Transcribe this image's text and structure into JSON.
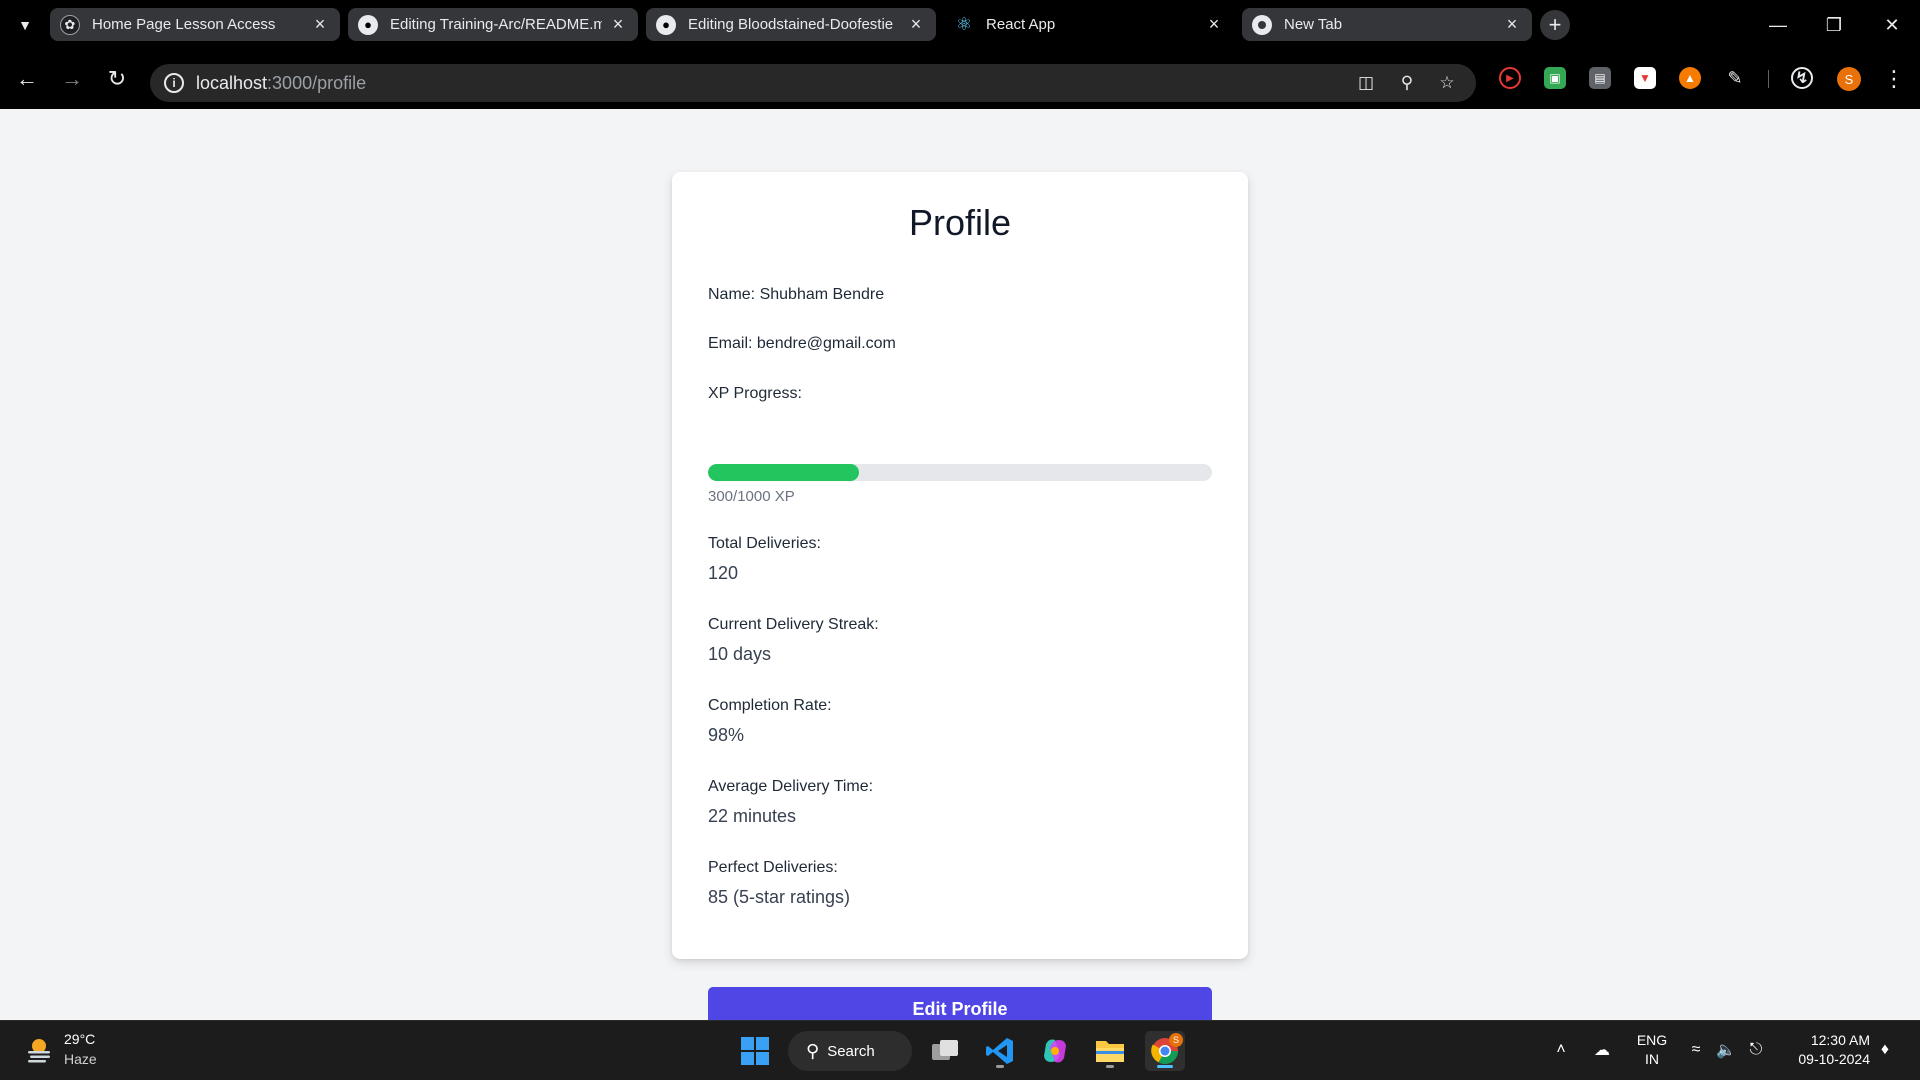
{
  "browser": {
    "tabs": [
      {
        "title": "Home Page Lesson Access",
        "icon": "openai-icon"
      },
      {
        "title": "Editing Training-Arc/README.m",
        "icon": "github-icon"
      },
      {
        "title": "Editing Bloodstained-Doofestie",
        "icon": "github-icon"
      },
      {
        "title": "React App",
        "icon": "react-icon"
      },
      {
        "title": "New Tab",
        "icon": "chrome-icon"
      }
    ],
    "url_host": "localhost",
    "url_path": ":3000/profile",
    "profile_initial": "S"
  },
  "profile": {
    "title": "Profile",
    "name_label": "Name: Shubham Bendre",
    "email_label": "Email: bendre@gmail.com",
    "xp_label": "XP Progress:",
    "xp_current": 300,
    "xp_max": 1000,
    "xp_text": "300/1000 XP",
    "stats": [
      {
        "label": "Total Deliveries:",
        "value": "120"
      },
      {
        "label": "Current Delivery Streak:",
        "value": "10 days"
      },
      {
        "label": "Completion Rate:",
        "value": "98%"
      },
      {
        "label": "Average Delivery Time:",
        "value": "22 minutes"
      },
      {
        "label": "Perfect Deliveries:",
        "value": "85 (5-star ratings)"
      }
    ],
    "edit_button": "Edit Profile",
    "accent_color": "#4f46e5",
    "progress_color": "#22c55e"
  },
  "taskbar": {
    "weather_temp": "29°C",
    "weather_condition": "Haze",
    "search_label": "Search",
    "lang_top": "ENG",
    "lang_bottom": "IN",
    "time": "12:30 AM",
    "date": "09-10-2024",
    "chrome_badge": "S"
  }
}
